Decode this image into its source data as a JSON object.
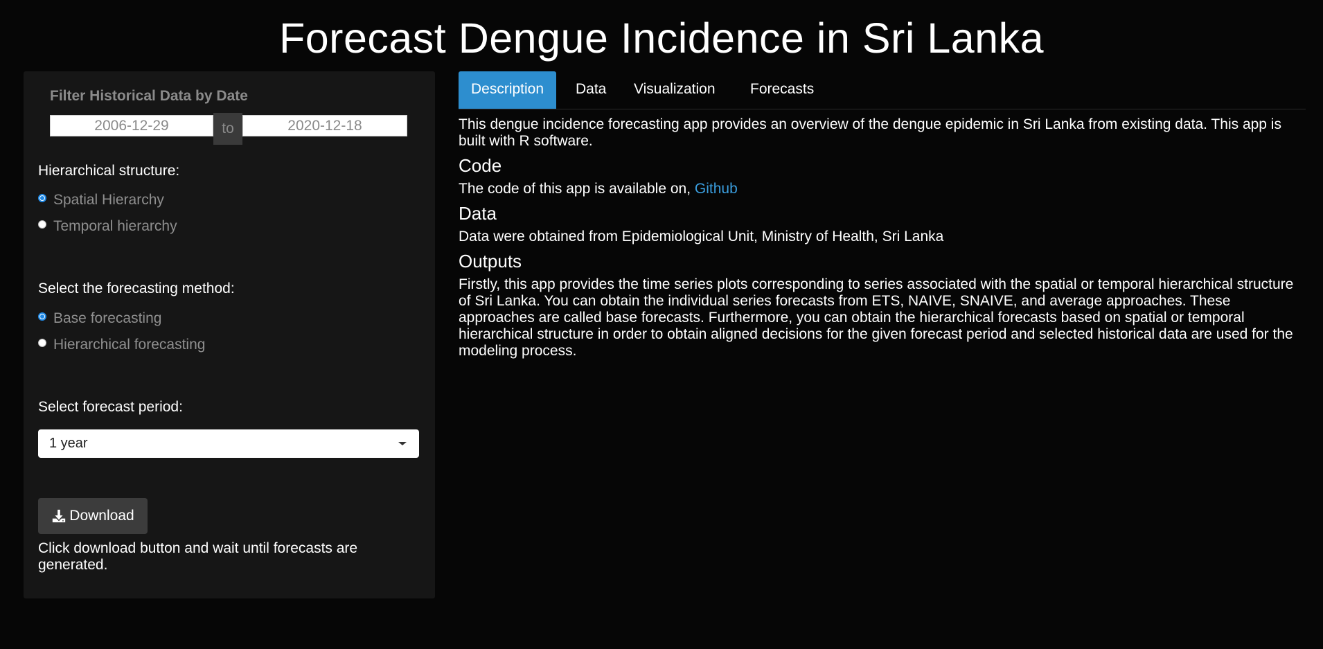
{
  "app": {
    "title": "Forecast Dengue Incidence in Sri Lanka"
  },
  "sidebar": {
    "date_filter": {
      "label": "Filter Historical Data by Date",
      "start": "2006-12-29",
      "separator": "to",
      "end": "2020-12-18"
    },
    "hierarchy": {
      "label": "Hierarchical structure:",
      "options": [
        {
          "label": "Spatial Hierarchy",
          "checked": true
        },
        {
          "label": "Temporal hierarchy",
          "checked": false
        }
      ]
    },
    "method": {
      "label": "Select the forecasting method:",
      "options": [
        {
          "label": "Base forecasting",
          "checked": true
        },
        {
          "label": "Hierarchical forecasting",
          "checked": false
        }
      ]
    },
    "period": {
      "label": "Select forecast period:",
      "selected": "1 year"
    },
    "download": {
      "label": "Download",
      "icon": "download-icon",
      "note": "Click download button and wait until forecasts are generated."
    }
  },
  "tabs": [
    {
      "label": "Description",
      "active": true
    },
    {
      "label": "Data",
      "active": false
    },
    {
      "label": "Visualization",
      "active": false
    },
    {
      "label": "Forecasts",
      "active": false
    }
  ],
  "description": {
    "intro": "This dengue incidence forecasting app provides an overview of the dengue epidemic in Sri Lanka from existing data. This app is built with R software.",
    "code_heading": "Code",
    "code_text": "The code of this app is available on, ",
    "code_link": "Github",
    "data_heading": "Data",
    "data_text": "Data were obtained from Epidemiological Unit, Ministry of Health, Sri Lanka",
    "outputs_heading": "Outputs",
    "outputs_text": "Firstly, this app provides the time series plots corresponding to series associated with the spatial or temporal hierarchical structure of Sri Lanka. You can obtain the individual series forecasts from ETS, NAIVE, SNAIVE, and average approaches. These approaches are called base forecasts. Furthermore, you can obtain the hierarchical forecasts based on spatial or temporal hierarchical structure in order to obtain aligned decisions for the given forecast period and selected historical data are used for the modeling process."
  },
  "colors": {
    "background": "#060606",
    "panel": "#161616",
    "accent": "#2d8ecf",
    "link": "#3a9ddd",
    "radio_checked": "#1e88e5"
  }
}
